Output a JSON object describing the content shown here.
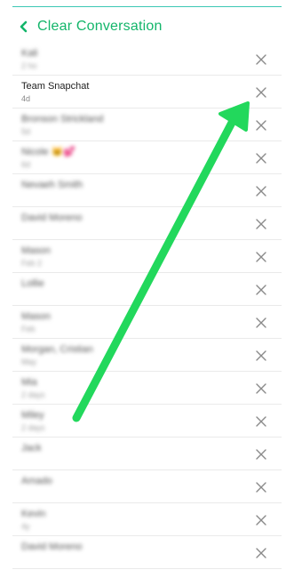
{
  "header": {
    "title": "Clear Conversation",
    "back_icon": "chevron-left-icon",
    "accent_color": "#13b56a"
  },
  "conversations": [
    {
      "name": "Kali",
      "sub": "2 ho",
      "blurred": true
    },
    {
      "name": "Team Snapchat",
      "sub": "4d",
      "blurred": false
    },
    {
      "name": "Bronson Strickland",
      "sub": "5d",
      "blurred": true
    },
    {
      "name": "Nicole 🐱💕",
      "sub": "6d",
      "blurred": true
    },
    {
      "name": "Nevaeh Smith",
      "sub": "",
      "blurred": true
    },
    {
      "name": "David Moreno",
      "sub": "",
      "blurred": true
    },
    {
      "name": "Mason",
      "sub": "Feb 2",
      "blurred": true
    },
    {
      "name": "Lollie",
      "sub": "",
      "blurred": true
    },
    {
      "name": "Mason",
      "sub": "Feb",
      "blurred": true
    },
    {
      "name": "Morgan, Cristian",
      "sub": "May",
      "blurred": true
    },
    {
      "name": "Mia",
      "sub": "2 days",
      "blurred": true
    },
    {
      "name": "Miley",
      "sub": "2 days",
      "blurred": true
    },
    {
      "name": "Jack",
      "sub": "",
      "blurred": true
    },
    {
      "name": "Amado",
      "sub": "",
      "blurred": true
    },
    {
      "name": "Kevin",
      "sub": "4y",
      "blurred": true
    },
    {
      "name": "David Moreno",
      "sub": "",
      "blurred": true
    }
  ],
  "row_action_icon": "close-icon",
  "annotation": {
    "type": "arrow",
    "color": "#22d85c",
    "points_to": "Team Snapchat close button"
  }
}
